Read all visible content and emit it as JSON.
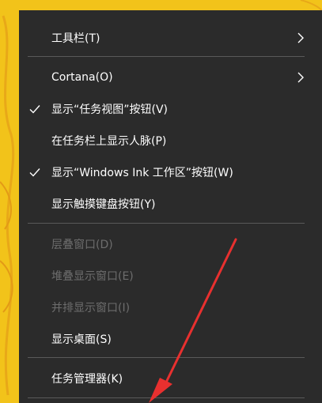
{
  "menu": {
    "items": [
      {
        "label": "工具栏(T)",
        "checked": false,
        "submenu": true,
        "disabled": false
      },
      {
        "label": "Cortana(O)",
        "checked": false,
        "submenu": true,
        "disabled": false
      },
      {
        "label": "显示“任务视图”按钮(V)",
        "checked": true,
        "submenu": false,
        "disabled": false
      },
      {
        "label": "在任务栏上显示人脉(P)",
        "checked": false,
        "submenu": false,
        "disabled": false
      },
      {
        "label": "显示“Windows Ink 工作区”按钮(W)",
        "checked": true,
        "submenu": false,
        "disabled": false
      },
      {
        "label": "显示触摸键盘按钮(Y)",
        "checked": false,
        "submenu": false,
        "disabled": false
      },
      {
        "label": "层叠窗口(D)",
        "checked": false,
        "submenu": false,
        "disabled": true
      },
      {
        "label": "堆叠显示窗口(E)",
        "checked": false,
        "submenu": false,
        "disabled": true
      },
      {
        "label": "并排显示窗口(I)",
        "checked": false,
        "submenu": false,
        "disabled": true
      },
      {
        "label": "显示桌面(S)",
        "checked": false,
        "submenu": false,
        "disabled": false
      },
      {
        "label": "任务管理器(K)",
        "checked": false,
        "submenu": false,
        "disabled": false
      }
    ]
  },
  "colors": {
    "menu_bg": "#2b2b2b",
    "text": "#ffffff",
    "disabled_text": "#6d6d6d",
    "separator": "#5a5a5a",
    "desktop_bg": "#f2c31a",
    "annotation_arrow": "#e8302f"
  }
}
